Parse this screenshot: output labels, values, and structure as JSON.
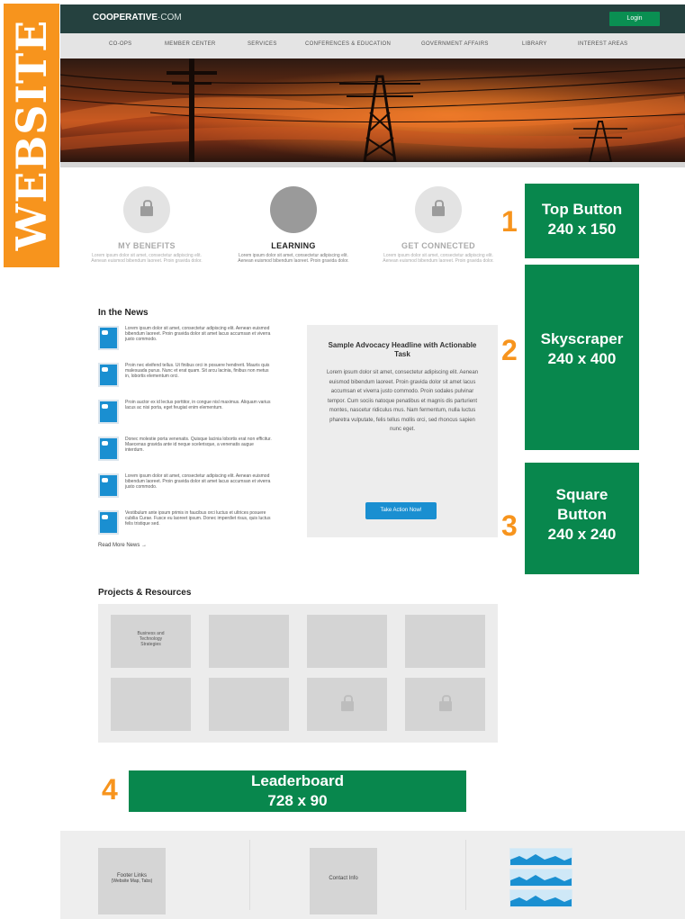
{
  "side_tag": "WEBSITE",
  "header": {
    "logo_main": "COOPERATIVE",
    "logo_suffix": "·COM",
    "login_label": "Login"
  },
  "nav": [
    "CO-OPS",
    "MEMBER CENTER",
    "SERVICES",
    "CONFERENCES & EDUCATION",
    "GOVERNMENT AFFAIRS",
    "LIBRARY",
    "INTEREST AREAS"
  ],
  "features": [
    {
      "title": "MY BENEFITS",
      "text": "Lorem ipsum dolor sit amet, consectetur adipiscing elit. Aenean euismod bibendum laoreet. Proin gravida dolor."
    },
    {
      "title": "LEARNING",
      "text": "Lorem ipsum dolor sit amet, consectetur adipiscing elit. Aenean euismod bibendum laoreet. Proin gravida dolor."
    },
    {
      "title": "GET CONNECTED",
      "text": "Lorem ipsum dolor sit amet, consectetur adipiscing elit. Aenean euismod bibendum laoreet. Proin gravida dolor."
    }
  ],
  "news": {
    "title": "In the News",
    "items": [
      "Lorem ipsum dolor sit amet, consectetur adipiscing elit. Aenean euismod bibendum laoreet. Proin gravida dolor sit amet lacus accumsan et viverra justo commodo.",
      "Proin nec eleifend tellus. Ut finibus orci in posuere hendrerit. Mauris quis malesuada purus. Nunc et erat quam. Sit arcu lacinia, finibus non metus in, lobortis elementum orci.",
      "Proin auctor ex id lectus porttitor, in congue nisl maximus. Aliquam varius lacus ac nisi porta, eget feugiat enim elementum.",
      "Donec molestie porta venenatis. Quisque lacinia lobortis erat non efficitur. Maecenas gravida ante id neque scelerisque, a venenatis augue interdum.",
      "Lorem ipsum dolor sit amet, consectetur adipiscing elit. Aenean euismod bibendum laoreet. Proin gravida dolor sit amet lacus accumsan et viverra justo commodo.",
      "Vestibulum ante ipsum primis in faucibus orci luctus et ultrices posuere cubilia Curae. Fusce eu laoreet ipsum. Donec imperdiet risus, quis luctus felis tristique sed."
    ],
    "read_more": "Read More News →"
  },
  "advocacy": {
    "headline": "Sample Advocacy Headline with Actionable Task",
    "body": "Lorem ipsum dolor sit amet, consectetur adipiscing elit. Aenean euismod bibendum laoreet. Proin gravida dolor sit amet lacus accumsan et viverra justo commodo. Proin sodales pulvinar tempor. Cum sociis natoque penatibus et magnis dis parturient montes, nascetur ridiculus mus. Nam fermentum, nulla luctus pharetra vulputate, felis tellus mollis orci, sed rhoncus sapien nunc eget.",
    "button": "Take Action Now!"
  },
  "projects": {
    "title": "Projects & Resources",
    "tile1_caption": "Business and Technology Strategies"
  },
  "footer": {
    "links_label": "Footer Links",
    "links_sub": "(Website Map, Tabs)",
    "contact_label": "Contact Info"
  },
  "ads": [
    {
      "number": "1",
      "name": "Top Button",
      "size": "240 x 150"
    },
    {
      "number": "2",
      "name": "Skyscraper",
      "size": "240 x 400"
    },
    {
      "number": "3",
      "name": "Square Button",
      "size": "240 x 240"
    },
    {
      "number": "4",
      "name": "Leaderboard",
      "size": "728 x 90"
    }
  ],
  "colors": {
    "accent_orange": "#f7941d",
    "ad_green": "#08874d",
    "header_dark": "#25413f",
    "link_blue": "#1a8fd1"
  }
}
